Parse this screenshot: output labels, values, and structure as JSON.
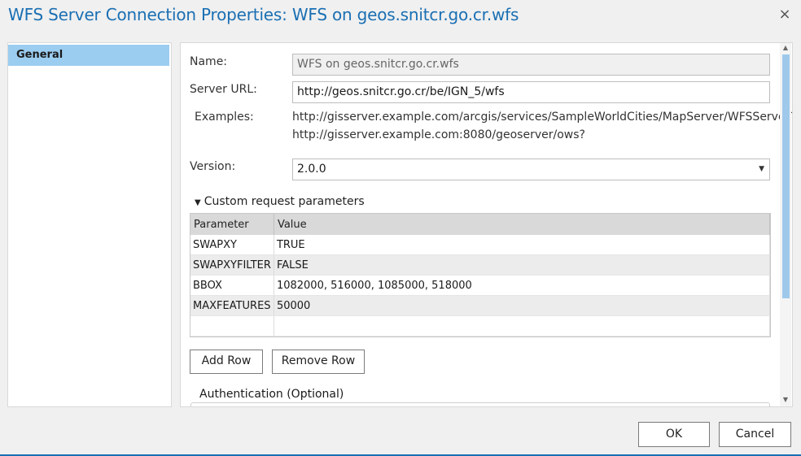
{
  "dialog": {
    "title": "WFS Server Connection Properties: WFS on geos.snitcr.go.cr.wfs",
    "close_icon": "×"
  },
  "nav": {
    "items": [
      {
        "label": "General",
        "selected": true
      }
    ]
  },
  "form": {
    "name_label": "Name:",
    "name_value": "WFS on geos.snitcr.go.cr.wfs",
    "url_label": "Server URL:",
    "url_value": "http://geos.snitcr.go.cr/be/IGN_5/wfs",
    "examples_label": "Examples:",
    "example1": "http://gisserver.example.com/arcgis/services/SampleWorldCities/MapServer/WFSServer?",
    "example2": "http://gisserver.example.com:8080/geoserver/ows?",
    "version_label": "Version:",
    "version_value": "2.0.0"
  },
  "params": {
    "section_label": "Custom request parameters",
    "col_parameter": "Parameter",
    "col_value": "Value",
    "rows": [
      {
        "parameter": "SWAPXY",
        "value": "TRUE"
      },
      {
        "parameter": "SWAPXYFILTER",
        "value": "FALSE"
      },
      {
        "parameter": "BBOX",
        "value": "1082000, 516000, 1085000, 518000"
      },
      {
        "parameter": "MAXFEATURES",
        "value": "50000"
      },
      {
        "parameter": "",
        "value": ""
      }
    ],
    "add_row": "Add Row",
    "remove_row": "Remove Row"
  },
  "auth": {
    "label": "Authentication (Optional)"
  },
  "footer": {
    "ok": "OK",
    "cancel": "Cancel"
  },
  "colors": {
    "accent": "#1a6fb3",
    "selected_nav": "#9bcdf0"
  }
}
